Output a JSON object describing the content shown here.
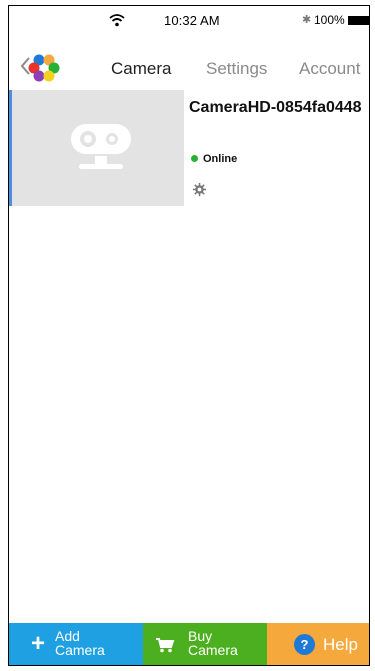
{
  "status_bar": {
    "time": "10:32 AM",
    "battery": "100%",
    "bluetooth_symbol": "✱"
  },
  "nav": {
    "tabs": [
      {
        "label": "Camera",
        "active": true
      },
      {
        "label": "Settings",
        "active": false
      },
      {
        "label": "Account",
        "active": false
      }
    ]
  },
  "camera_list": {
    "items": [
      {
        "name": "CameraHD-0854fa0448",
        "status": "Online",
        "status_color": "#27b035"
      }
    ]
  },
  "bottom_bar": {
    "add_line1": "Add",
    "add_line2": "Camera",
    "buy_line1": "Buy",
    "buy_line2": "Camera",
    "help": "Help",
    "help_icon_glyph": "?"
  },
  "colors": {
    "add": "#1fa0e3",
    "buy": "#4caf1f",
    "help": "#f5a93c",
    "accent": "#4a90e2"
  }
}
